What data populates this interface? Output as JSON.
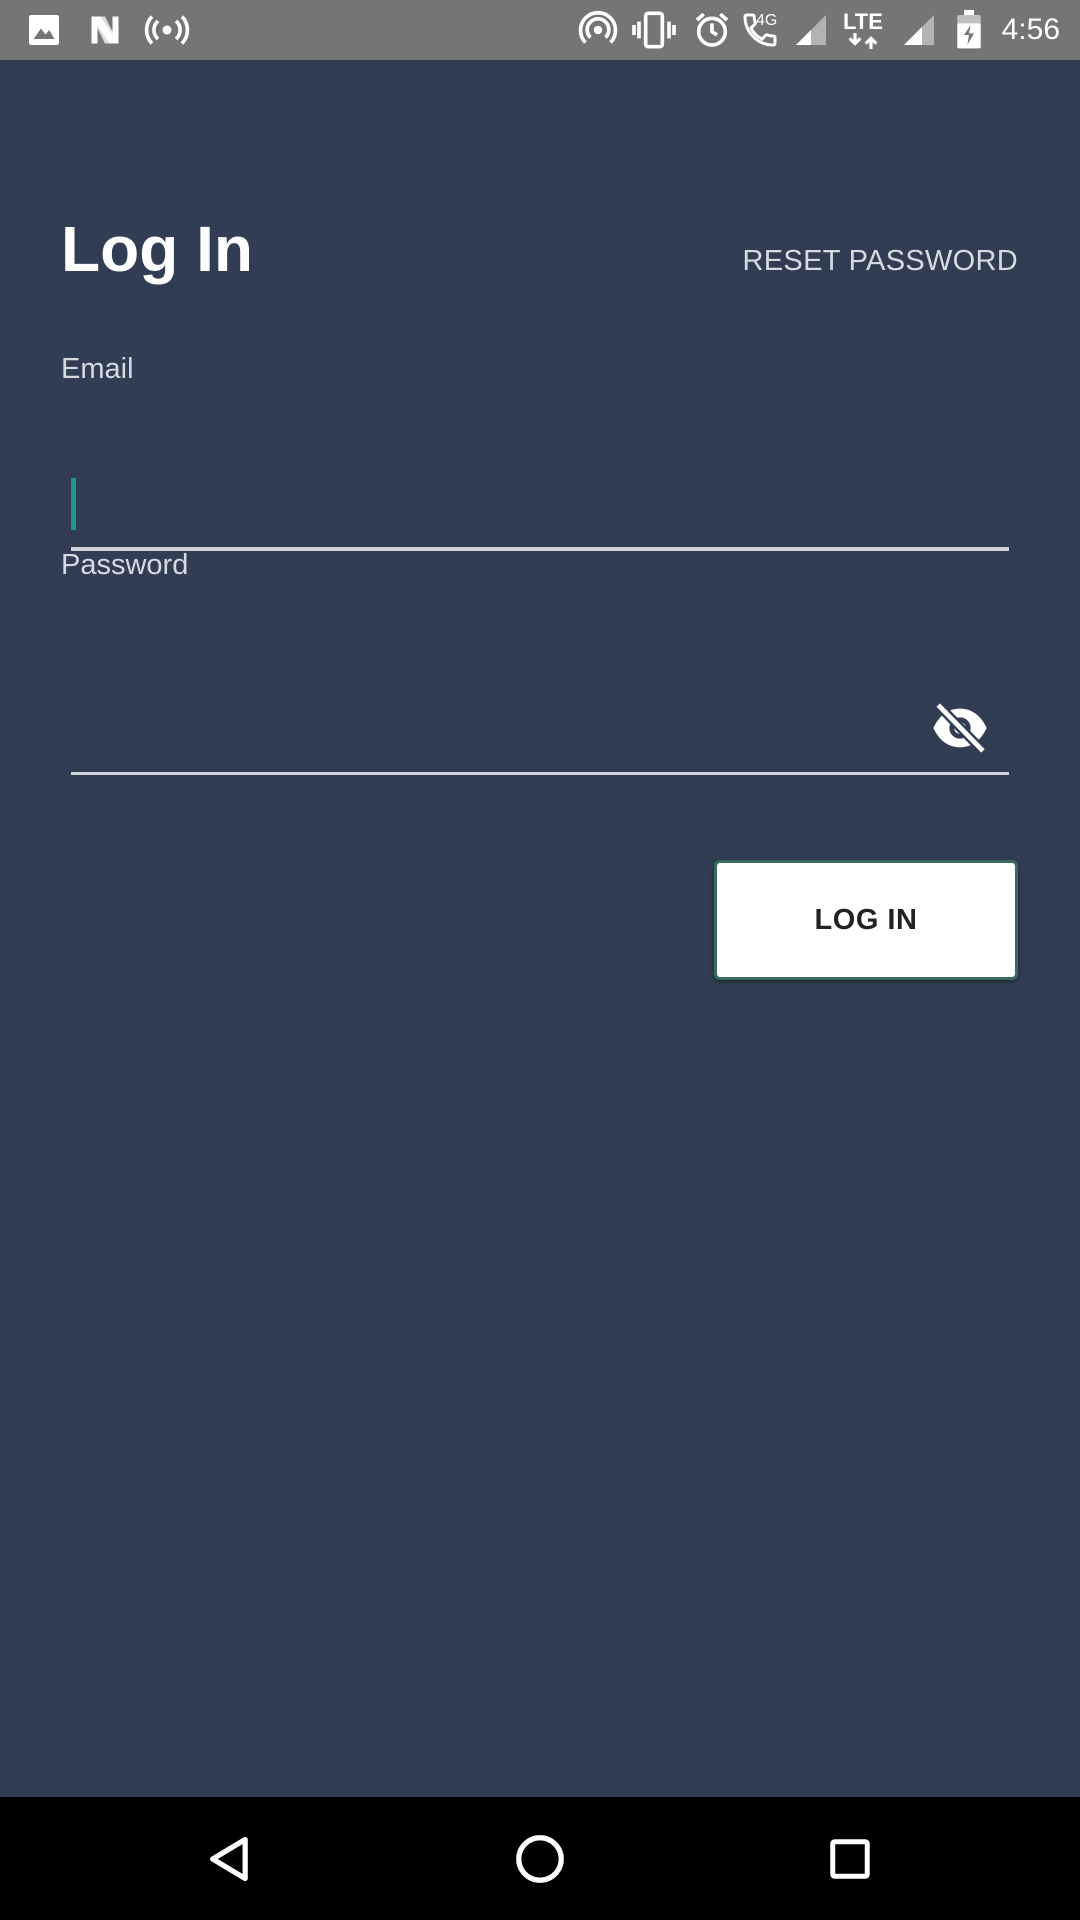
{
  "status_bar": {
    "time": "4:56",
    "network_4g_label": "4G",
    "lte_label": "LTE",
    "icons": [
      "image-icon",
      "n-app-icon",
      "broadcast-icon",
      "hotspot-icon",
      "vibrate-icon",
      "alarm-icon",
      "wifi-calling-icon",
      "signal-icon",
      "lte-icon",
      "signal-icon-2",
      "battery-charging-icon"
    ]
  },
  "login": {
    "title": "Log In",
    "reset_label": "RESET PASSWORD",
    "email_label": "Email",
    "email_value": "",
    "password_label": "Password",
    "password_value": "",
    "password_toggle_icon": "eye-off-icon",
    "submit_label": "LOG IN"
  },
  "colors": {
    "background": "#303d52",
    "status_bar": "#757575",
    "caret": "#1a9a8a",
    "button_border": "#3b6b60",
    "nav_bar": "#000000"
  },
  "nav_bar": {
    "icons": [
      "back-icon",
      "home-icon",
      "recents-icon"
    ]
  }
}
